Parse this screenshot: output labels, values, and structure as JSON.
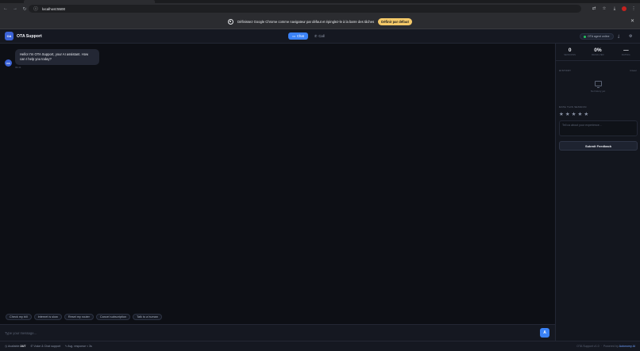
{
  "browser": {
    "url": "localhost:5500",
    "infobar": {
      "message": "Définissez Google Chrome comme navigateur par défaut et épinglez-le à la barre des tâches",
      "button": "Définir par défaut"
    }
  },
  "header": {
    "logo_text": "OA",
    "title": "OTA Support",
    "tabs": [
      {
        "label": "Chat",
        "icon": "chat-bubble-icon",
        "active": true
      },
      {
        "label": "Call",
        "icon": "phone-icon",
        "active": false
      }
    ],
    "agent_status": "OTA agent online",
    "status_color": "#22c55e"
  },
  "chat": {
    "bot_avatar": "OA",
    "messages": [
      {
        "text": "Hello! I'm OTA Support, your AI assistant. How can I help you today?",
        "time": "09:41"
      }
    ],
    "quick_replies": [
      "Check my bill",
      "Internet is slow",
      "Reset my router",
      "Cancel subscription",
      "Talk to a human"
    ],
    "input_placeholder": "Type your message...",
    "send_label": "A"
  },
  "panel": {
    "stats": [
      {
        "value": "0",
        "label": "SESSIONS"
      },
      {
        "value": "0%",
        "label": "RESOLVED"
      },
      {
        "value": "—",
        "label": "RATING"
      }
    ],
    "history_title": "HISTORY",
    "history_clear": "Clear",
    "history_empty": "No history yet",
    "rate_title": "RATE THIS SESSION",
    "feedback_placeholder": "Tell us about your experience...",
    "submit_label": "Submit Feedback"
  },
  "footer": {
    "availability_label": "Available",
    "availability_value": "24/7",
    "channels": "Voice & Chat support",
    "avg_response": "Avg. response < 3s",
    "version": "OTA Support v1.0",
    "powered_prefix": "Powered by",
    "powered_brand": "Autonomy AI"
  },
  "colors": {
    "accent": "#3b82f6",
    "brand": "#3b63d8",
    "infobar_button": "#f4c969"
  }
}
